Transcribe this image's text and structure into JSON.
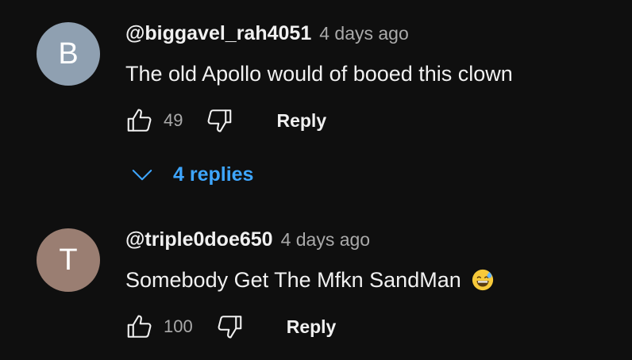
{
  "comments": [
    {
      "avatar_letter": "B",
      "avatar_color": "#8fa0b1",
      "username": "@biggavel_rah4051",
      "time": "4 days ago",
      "text": "The old Apollo would of booed this clown",
      "like_count": "49",
      "reply_label": "Reply",
      "replies_label": "4 replies"
    },
    {
      "avatar_letter": "T",
      "avatar_color": "#9a7e72",
      "username": "@triple0doe650",
      "time": "4 days ago",
      "text": "Somebody Get The Mfkn SandMan",
      "emoji": "grinning-sweat-emoji",
      "like_count": "100",
      "reply_label": "Reply"
    }
  ],
  "colors": {
    "background": "#0f0f0f",
    "link_blue": "#3ea6ff",
    "secondary_text": "#aaaaaa"
  }
}
